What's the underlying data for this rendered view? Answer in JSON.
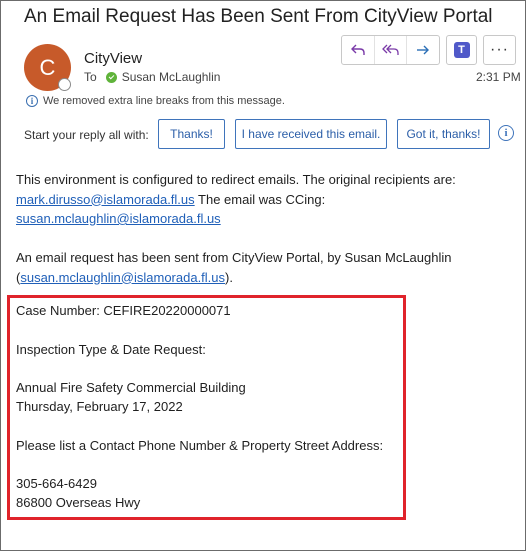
{
  "email": {
    "subject": "An Email Request Has Been Sent From CityView Portal",
    "avatar_initial": "C",
    "sender": "CityView",
    "to_label": "To",
    "recipient": "Susan McLaughlin",
    "time": "2:31 PM",
    "info_message": "We removed extra line breaks from this message."
  },
  "actions": {
    "reply_icon": "reply-icon",
    "reply_all_icon": "reply-all-icon",
    "forward_icon": "forward-icon",
    "teams_icon": "teams-icon",
    "teams_letter": "T",
    "more_icon": "more-options-icon",
    "more_glyph": "···"
  },
  "quick_replies": {
    "label": "Start your reply all with:",
    "options": [
      "Thanks!",
      "I have received this email.",
      "Got it, thanks!"
    ]
  },
  "body": {
    "line1": "This environment is configured to redirect emails.  The original recipients are:",
    "email1": "mark.dirusso@islamorada.fl.us",
    "line2_rest": " The email was CCing:",
    "email2": "susan.mclaughlin@islamorada.fl.us",
    "line3": "An email request has been sent from CityView Portal, by Susan McLaughlin",
    "paren_open": "(",
    "email3": "susan.mclaughlin@islamorada.fl.us",
    "paren_close": ")."
  },
  "details": {
    "case_number": "Case Number: CEFIRE20220000071",
    "inspection_heading": "Inspection Type & Date Request:",
    "inspection_type": "Annual Fire Safety Commercial Building",
    "inspection_date": "Thursday, February 17, 2022",
    "contact_heading": "Please list a Contact Phone Number & Property Street Address:",
    "phone": "305-664-6429",
    "address": "86800 Overseas Hwy"
  },
  "colors": {
    "avatar": "#c75a2a",
    "link": "#1f5fb8",
    "highlight_border": "#e0232b",
    "presence": "#5fb33a"
  }
}
